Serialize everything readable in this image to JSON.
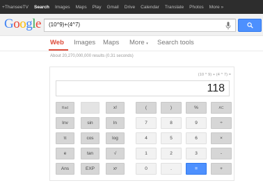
{
  "topbar": {
    "items": [
      "+ThanseeTV",
      "Search",
      "Images",
      "Maps",
      "Play",
      "Gmail",
      "Drive",
      "Calendar",
      "Translate",
      "Photos",
      "More »"
    ]
  },
  "logo": {
    "text": "Google",
    "colors": [
      "#4285f4",
      "#ea4335",
      "#fbbc05",
      "#4285f4",
      "#34a853",
      "#ea4335"
    ]
  },
  "search": {
    "query": "(10^9)+(4^7)"
  },
  "tabs": [
    "Web",
    "Images",
    "Maps",
    "More",
    "Search tools"
  ],
  "result_stats": "About 20,270,000,000 results (0.31 seconds)",
  "calculator": {
    "expression": "(10 ^ 9) + (4 ^ 7) =",
    "result": "118",
    "keys": [
      [
        "Rad",
        "",
        "x!",
        "(",
        ")",
        "%",
        "AC"
      ],
      [
        "Inv",
        "sin",
        "ln",
        "7",
        "8",
        "9",
        "÷"
      ],
      [
        "π",
        "cos",
        "log",
        "4",
        "5",
        "6",
        "×"
      ],
      [
        "e",
        "tan",
        "√",
        "1",
        "2",
        "3",
        "-"
      ],
      [
        "Ans",
        "EXP",
        "xʸ",
        "0",
        ".",
        "=",
        "+"
      ]
    ]
  },
  "colors": {
    "accent": "#dd4b39",
    "button_blue": "#4d90fe",
    "topbar": "#2d2d2d"
  }
}
